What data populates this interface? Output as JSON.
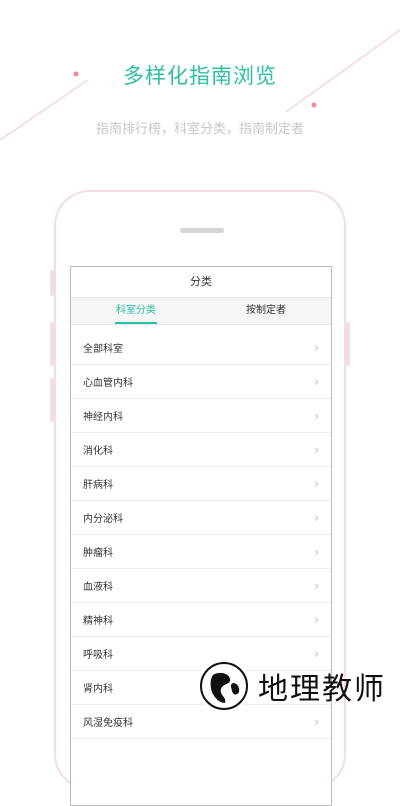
{
  "banner": {
    "headline": "多样化指南浏览",
    "subline": "指南排行榜，科室分类，指南制定者"
  },
  "screen": {
    "title": "分类",
    "tabs": [
      {
        "label": "科室分类",
        "active": true
      },
      {
        "label": "按制定者",
        "active": false
      }
    ],
    "rows": [
      {
        "label": "全部科室"
      },
      {
        "label": "心血管内科"
      },
      {
        "label": "神经内科"
      },
      {
        "label": "消化科"
      },
      {
        "label": "肝病科"
      },
      {
        "label": "内分泌科"
      },
      {
        "label": "肿瘤科"
      },
      {
        "label": "血液科"
      },
      {
        "label": "精神科"
      },
      {
        "label": "呼吸科"
      },
      {
        "label": "肾内科"
      },
      {
        "label": "风湿免疫科"
      }
    ],
    "chevron": "›"
  },
  "watermark": {
    "text": "地理教师"
  },
  "colors": {
    "accent": "#2bbfa6",
    "phone_frame": "#f4dde2",
    "deco_line": "#f2c4cc"
  }
}
